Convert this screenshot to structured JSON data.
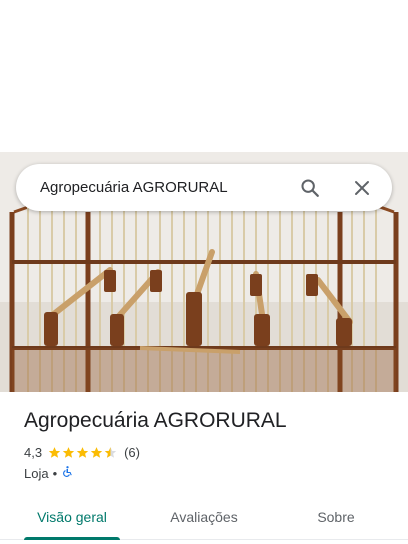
{
  "search": {
    "query": "Agropecuária AGRORURAL",
    "search_icon": "search-icon",
    "close_icon": "close-icon"
  },
  "photo": {
    "subject": "bird-cage-photo"
  },
  "place": {
    "name": "Agropecuária AGRORURAL",
    "rating": "4,3",
    "rating_fraction": 0.86,
    "review_count": "(6)",
    "category": "Loja",
    "separator": "•",
    "accessibility_icon": "wheelchair-icon"
  },
  "tabs": [
    {
      "label": "Visão geral",
      "active": true
    },
    {
      "label": "Avaliações",
      "active": false
    },
    {
      "label": "Sobre",
      "active": false
    }
  ],
  "colors": {
    "accent": "#00796b",
    "star": "#fbbc04",
    "accessibility": "#1a73e8"
  }
}
